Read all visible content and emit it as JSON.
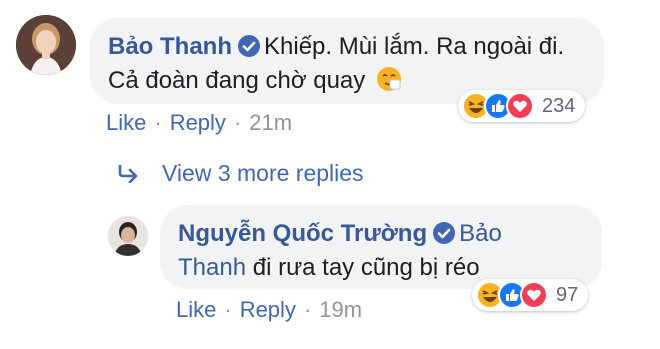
{
  "comment": {
    "author": "Bảo Thanh",
    "text_line1": "Khiếp. Mùi lắm. Ra ngoài đi.",
    "text_line2": "Cả đoàn đang chờ quay",
    "emoji_name": "sneezing-face",
    "reaction_count": "234",
    "reactions": [
      "haha",
      "like",
      "love"
    ],
    "actions": {
      "like": "Like",
      "reply": "Reply",
      "time": "21m"
    }
  },
  "view_more": {
    "label": "View 3 more replies",
    "icon": "reply-arrow-icon"
  },
  "reply": {
    "author": "Nguyễn Quốc Trường",
    "mention_part1": "Bảo",
    "mention_part2": "Thanh",
    "text": " đi rưa tay cũng bị réo",
    "reaction_count": "97",
    "reactions": [
      "haha",
      "like",
      "love"
    ],
    "actions": {
      "like": "Like",
      "reply": "Reply",
      "time": "19m"
    }
  },
  "colors": {
    "link": "#385898",
    "action_link": "#4267b2",
    "bubble": "#f2f3f5",
    "muted": "#90949c",
    "verified": "#4267b2",
    "love": "#f33e58",
    "haha": "#f7b125"
  }
}
